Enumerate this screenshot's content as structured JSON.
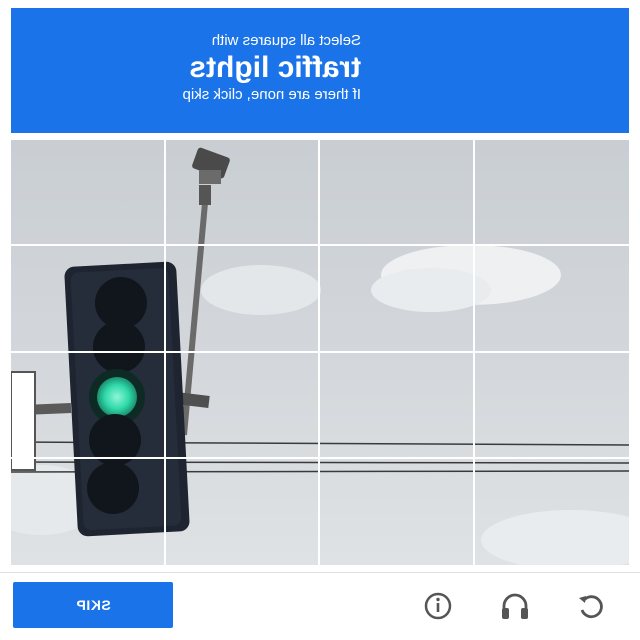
{
  "prompt": {
    "line1": "Select all squares with",
    "target": "traffic lights",
    "line3": "If there are none, click skip"
  },
  "footer": {
    "skip_label": "SKIP",
    "icons": [
      "info-icon",
      "headphones-icon",
      "refresh-icon"
    ]
  },
  "grid": {
    "rows": 4,
    "cols": 4
  },
  "colors": {
    "accent": "#1a73e8",
    "signal_green": "#2fd9a9"
  }
}
